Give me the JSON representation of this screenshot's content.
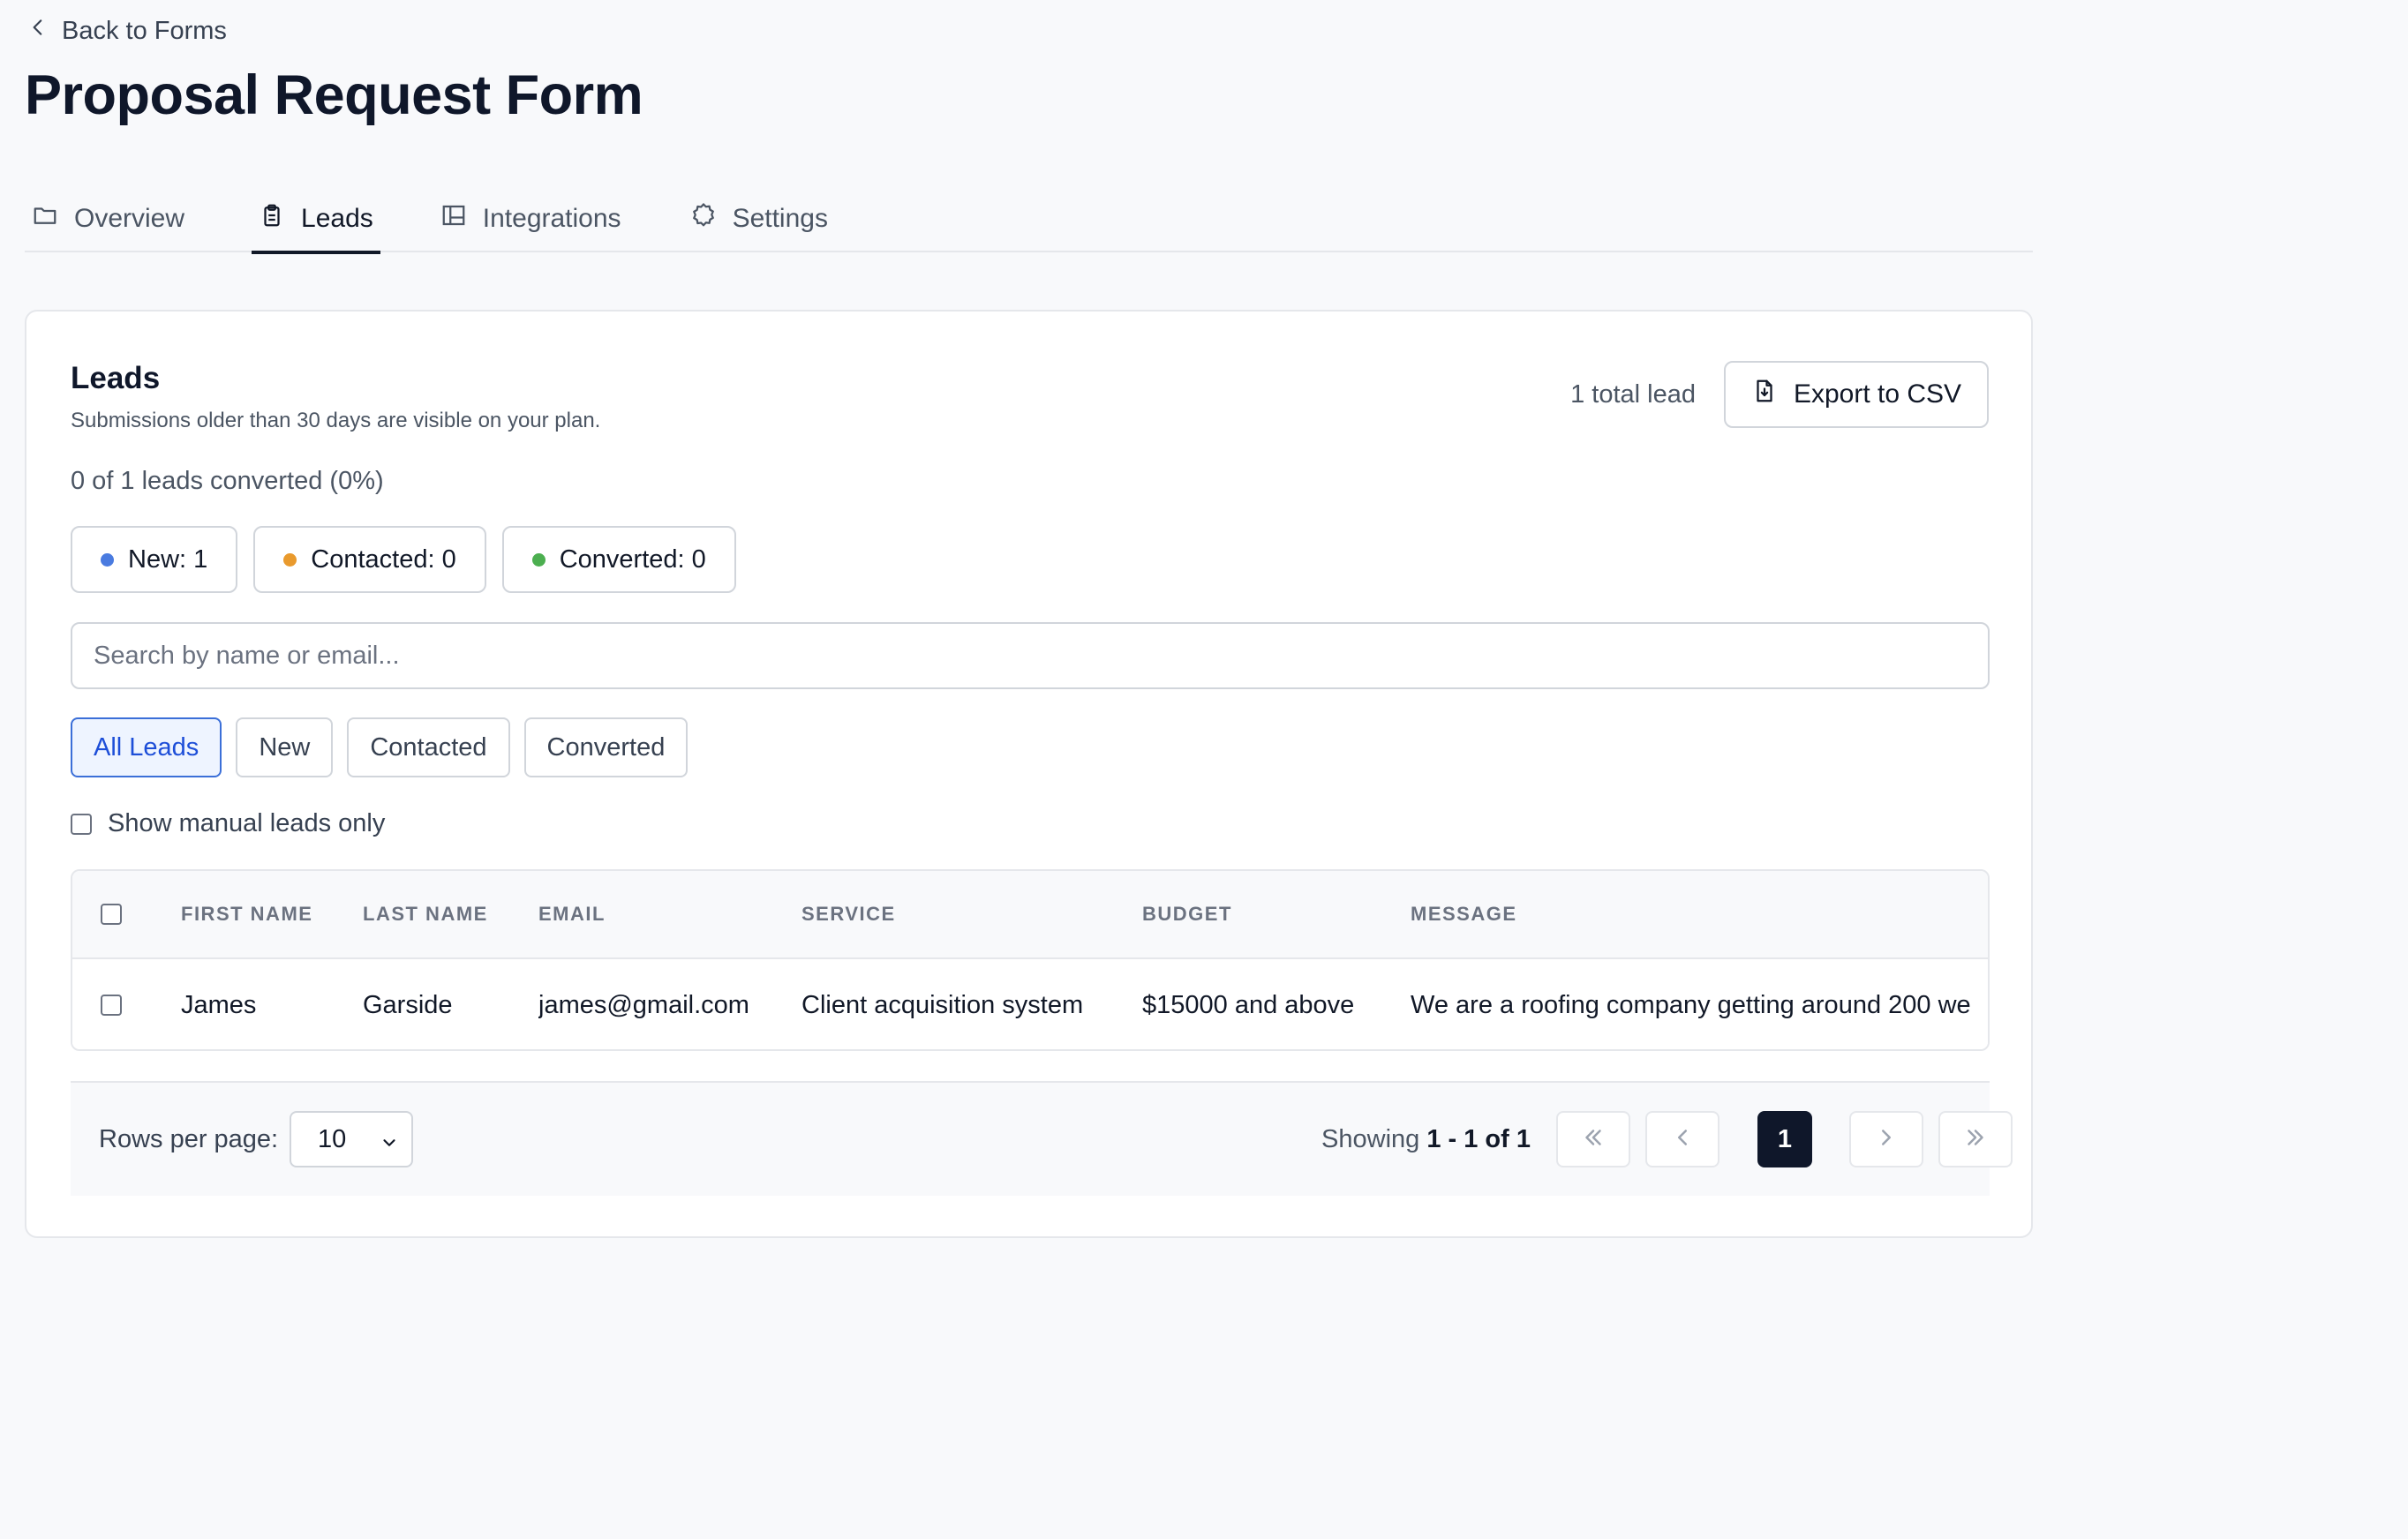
{
  "nav": {
    "back_label": "Back to Forms"
  },
  "page": {
    "title": "Proposal Request Form"
  },
  "tabs": [
    {
      "label": "Overview",
      "icon": "folder-icon",
      "active": false
    },
    {
      "label": "Leads",
      "icon": "clipboard-icon",
      "active": true
    },
    {
      "label": "Integrations",
      "icon": "layout-icon",
      "active": false
    },
    {
      "label": "Settings",
      "icon": "gear-icon",
      "active": false
    }
  ],
  "leads": {
    "title": "Leads",
    "subtitle": "Submissions older than 30 days are visible on your plan.",
    "total_label": "1 total lead",
    "export_label": "Export to CSV",
    "converted_summary": "0 of 1 leads converted (0%)",
    "status_counts": [
      {
        "label": "New: 1",
        "color": "#4a7be0"
      },
      {
        "label": "Contacted: 0",
        "color": "#e99a2d"
      },
      {
        "label": "Converted: 0",
        "color": "#4caf50"
      }
    ],
    "search_placeholder": "Search by name or email...",
    "filters": [
      "All Leads",
      "New",
      "Contacted",
      "Converted"
    ],
    "active_filter": "All Leads",
    "manual_only_label": "Show manual leads only",
    "manual_only_checked": false
  },
  "table": {
    "columns": [
      "FIRST NAME",
      "LAST NAME",
      "EMAIL",
      "SERVICE",
      "BUDGET",
      "MESSAGE"
    ],
    "rows": [
      {
        "first_name": "James",
        "last_name": "Garside",
        "email": "james@gmail.com",
        "service": "Client acquisition system",
        "budget": "$15000 and above",
        "message": "We are a roofing company getting around 200 we"
      }
    ]
  },
  "pagination": {
    "rows_per_page_label": "Rows per page:",
    "rows_per_page_value": "10",
    "showing_prefix": "Showing",
    "showing_range": "1 - 1 of 1",
    "current_page": "1"
  },
  "colors": {
    "accent": "#1d4ed8",
    "dark": "#0f172a"
  }
}
